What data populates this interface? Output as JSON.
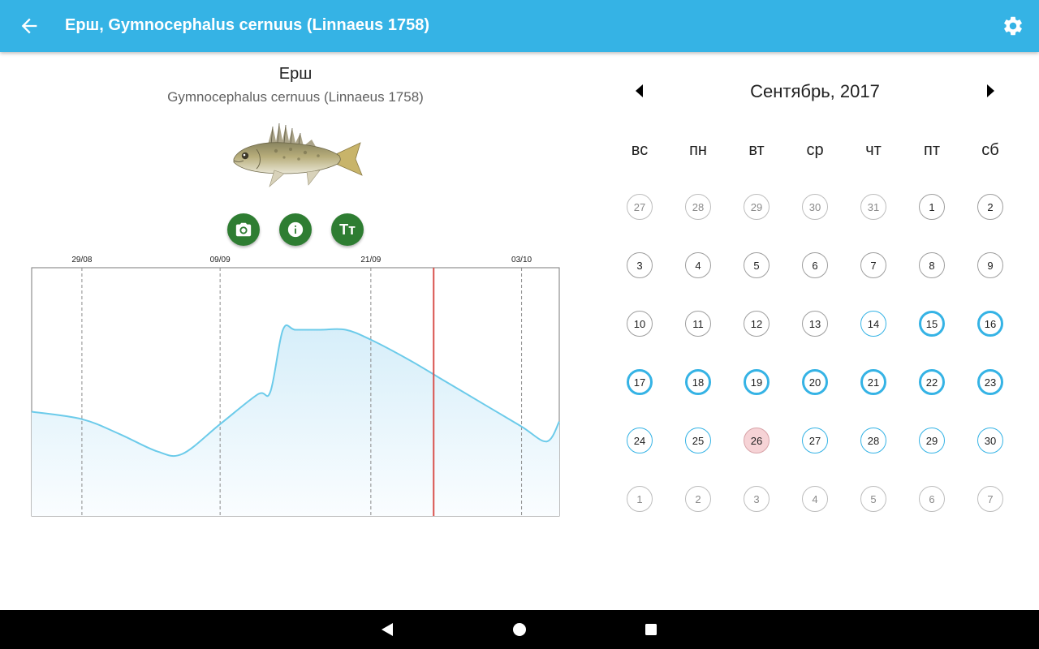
{
  "app_bar": {
    "title": "Ерш, Gymnocephalus cernuus (Linnaeus 1758)"
  },
  "species": {
    "name": "Ерш",
    "latin": "Gymnocephalus cernuus (Linnaeus 1758)"
  },
  "actions": {
    "text_size_label": "Тт"
  },
  "chart_data": {
    "type": "area",
    "x_tick_labels": [
      "29/08",
      "09/09",
      "21/09",
      "03/10"
    ],
    "current_marker": "26/09",
    "line_color": "#6ccbea",
    "marker_color": "#d9534f",
    "y_axis_labels": false,
    "values": [
      [
        "2017-08-27",
        42
      ],
      [
        "2017-08-29",
        39
      ],
      [
        "2017-09-01",
        33
      ],
      [
        "2017-09-04",
        26
      ],
      [
        "2017-09-06",
        25
      ],
      [
        "2017-09-09",
        37
      ],
      [
        "2017-09-12",
        49
      ],
      [
        "2017-09-13",
        50
      ],
      [
        "2017-09-14",
        75
      ],
      [
        "2017-09-15",
        75
      ],
      [
        "2017-09-17",
        75
      ],
      [
        "2017-09-19",
        75
      ],
      [
        "2017-09-21",
        71
      ],
      [
        "2017-09-24",
        63
      ],
      [
        "2017-09-27",
        54
      ],
      [
        "2017-09-30",
        45
      ],
      [
        "2017-10-03",
        36
      ],
      [
        "2017-10-05",
        30
      ],
      [
        "2017-10-06",
        38
      ]
    ]
  },
  "calendar": {
    "month_title": "Сентябрь, 2017",
    "weekdays": [
      "вс",
      "пн",
      "вт",
      "ср",
      "чт",
      "пт",
      "сб"
    ],
    "weeks": [
      [
        {
          "d": "27",
          "s": "other"
        },
        {
          "d": "28",
          "s": "other"
        },
        {
          "d": "29",
          "s": "other"
        },
        {
          "d": "30",
          "s": "other"
        },
        {
          "d": "31",
          "s": "other"
        },
        {
          "d": "1",
          "s": "normal"
        },
        {
          "d": "2",
          "s": "normal"
        }
      ],
      [
        {
          "d": "3",
          "s": "normal"
        },
        {
          "d": "4",
          "s": "normal"
        },
        {
          "d": "5",
          "s": "normal"
        },
        {
          "d": "6",
          "s": "normal"
        },
        {
          "d": "7",
          "s": "normal"
        },
        {
          "d": "8",
          "s": "normal"
        },
        {
          "d": "9",
          "s": "normal"
        }
      ],
      [
        {
          "d": "10",
          "s": "normal"
        },
        {
          "d": "11",
          "s": "normal"
        },
        {
          "d": "12",
          "s": "normal"
        },
        {
          "d": "13",
          "s": "normal"
        },
        {
          "d": "14",
          "s": "h1"
        },
        {
          "d": "15",
          "s": "h2"
        },
        {
          "d": "16",
          "s": "h2"
        }
      ],
      [
        {
          "d": "17",
          "s": "h2"
        },
        {
          "d": "18",
          "s": "h2"
        },
        {
          "d": "19",
          "s": "h2"
        },
        {
          "d": "20",
          "s": "h2"
        },
        {
          "d": "21",
          "s": "h2"
        },
        {
          "d": "22",
          "s": "h2"
        },
        {
          "d": "23",
          "s": "h2"
        }
      ],
      [
        {
          "d": "24",
          "s": "h1"
        },
        {
          "d": "25",
          "s": "h1"
        },
        {
          "d": "26",
          "s": "today"
        },
        {
          "d": "27",
          "s": "h1"
        },
        {
          "d": "28",
          "s": "h1"
        },
        {
          "d": "29",
          "s": "h1"
        },
        {
          "d": "30",
          "s": "h1"
        }
      ],
      [
        {
          "d": "1",
          "s": "other"
        },
        {
          "d": "2",
          "s": "other"
        },
        {
          "d": "3",
          "s": "other"
        },
        {
          "d": "4",
          "s": "other"
        },
        {
          "d": "5",
          "s": "other"
        },
        {
          "d": "6",
          "s": "other"
        },
        {
          "d": "7",
          "s": "other"
        }
      ]
    ]
  },
  "colors": {
    "primary": "#35b3e5",
    "action_green": "#2e7d32",
    "today_bg": "#f6d3d6"
  }
}
